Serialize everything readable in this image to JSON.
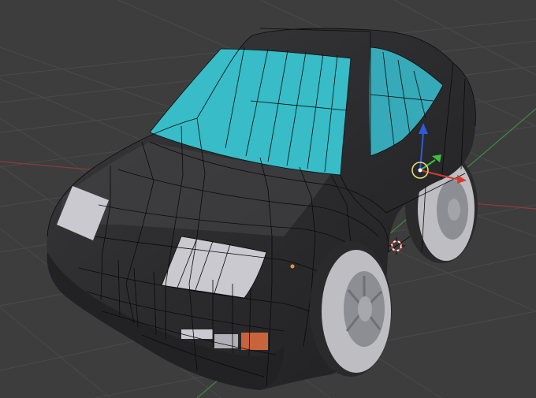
{
  "viewport": {
    "title": "",
    "background_color": "#3d3d3d",
    "grid_line_color": "#4a4a4a",
    "x_axis_color": "#8f3a3a",
    "y_axis_color": "#3e8a3e"
  },
  "object": {
    "name": "",
    "body_color": "#2c2c2e",
    "body_highlight_color": "#4a4a4d",
    "glass_color": "#38bcc7",
    "glass_side_color": "#36aab8",
    "light_color": "#c9c9cf",
    "indicator_color": "#c8643c",
    "wire_color": "#0b0b0b",
    "tire_color": "#bdbdc2",
    "rim_color": "#8d8d94"
  },
  "gizmo": {
    "z_axis_color": "#2f5bd8",
    "y_axis_color": "#3fbf3f",
    "x_axis_color": "#d63b2f",
    "pivot_color": "#e8e27a"
  },
  "cursor_3d": {
    "ring_color_a": "#ffffff",
    "ring_color_b": "#e03030"
  }
}
